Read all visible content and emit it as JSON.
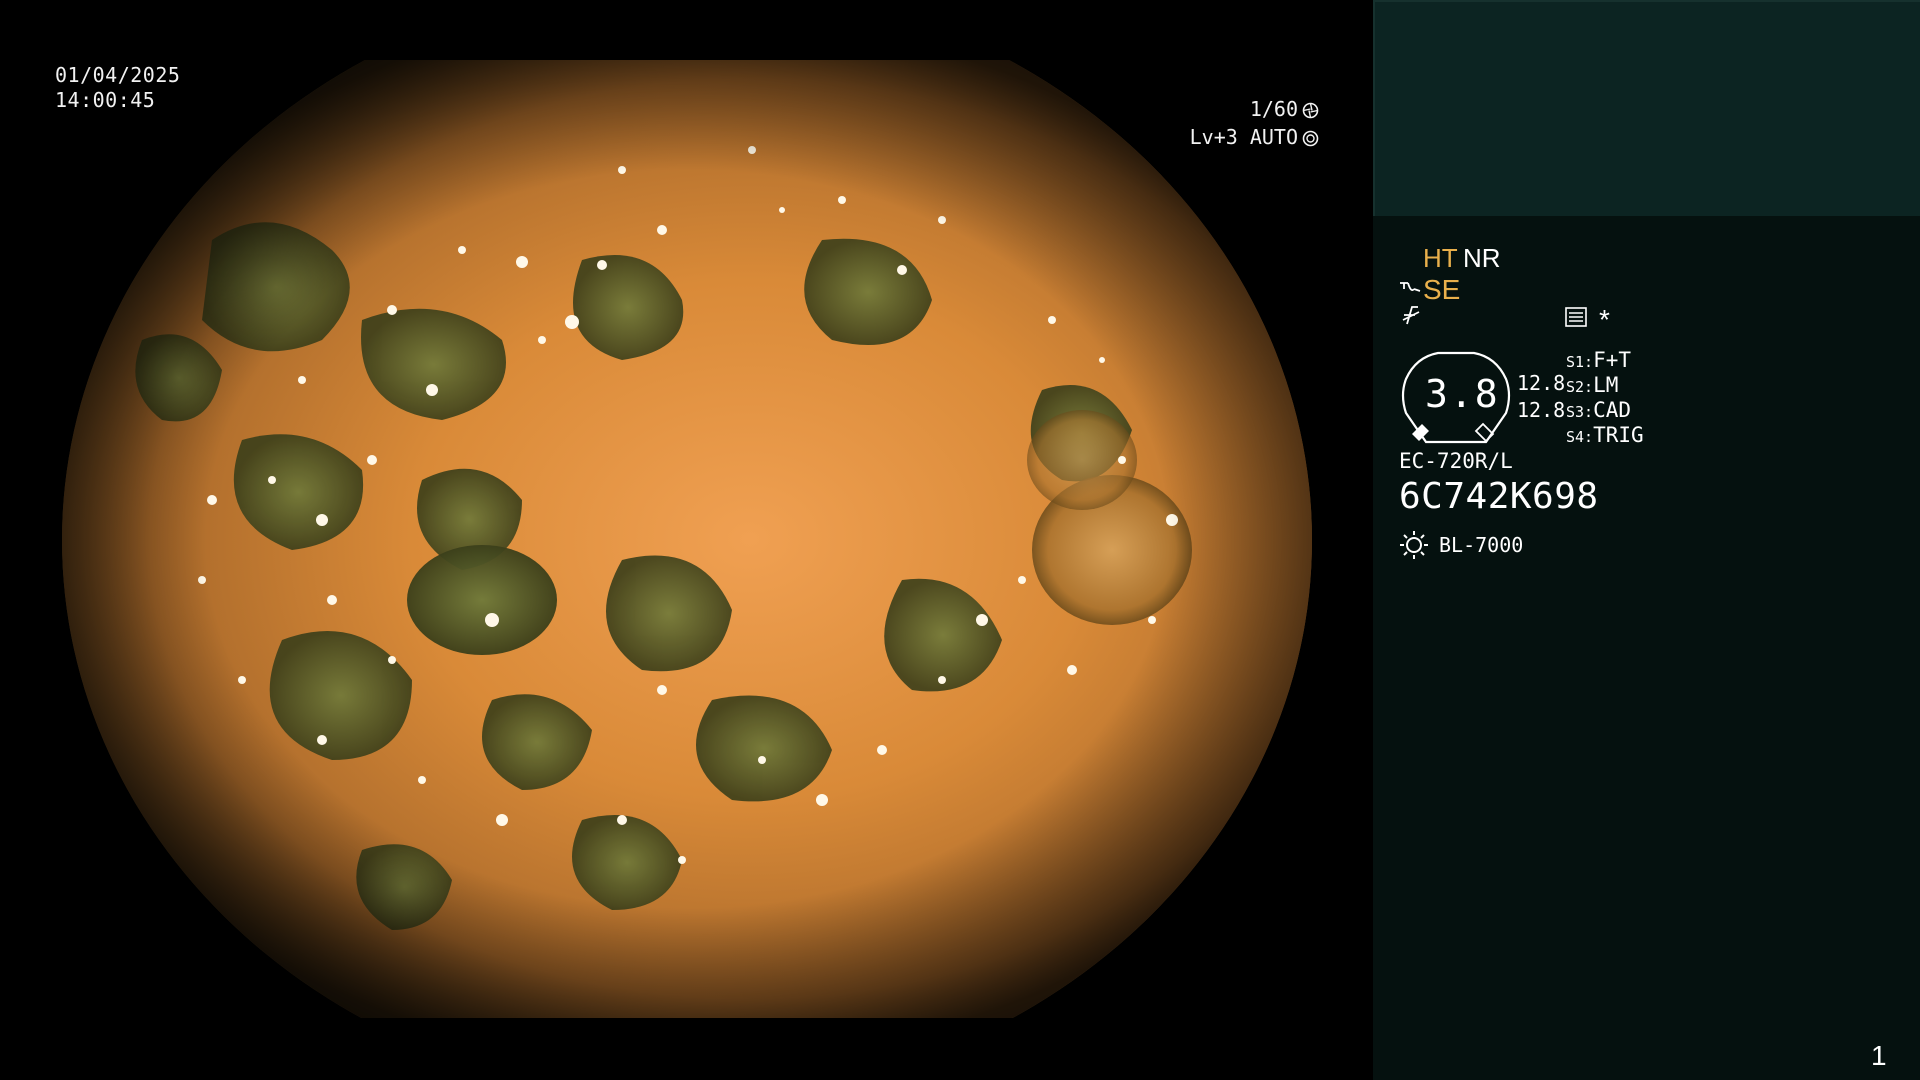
{
  "overlay": {
    "date": "01/04/2025",
    "time": "14:00:45",
    "shutter": "1/60",
    "level": "Lv+3 AUTO"
  },
  "panel": {
    "mode_ht": "HT",
    "mode_nr": "NR",
    "mode_se": "SE",
    "zoom_value": "3.8",
    "gain_1": "12.8",
    "gain_2": "12.8",
    "switches": [
      {
        "key": "S1:",
        "value": "F+T"
      },
      {
        "key": "S2:",
        "value": "LM"
      },
      {
        "key": "S3:",
        "value": "CAD"
      },
      {
        "key": "S4:",
        "value": "TRIG"
      }
    ],
    "asterisk": "*",
    "scope_model": "EC-720R/L",
    "serial": "6C742K698",
    "light_source": "BL-7000",
    "page_number": "1"
  },
  "colors": {
    "panel_bg": "#05110f",
    "panel_header_bg": "#0c2422",
    "accent_amber": "#e9b04c",
    "text": "#ffffff"
  },
  "icons": [
    "shutter-aperture-icon",
    "auto-iris-icon",
    "se-mode-icon",
    "f-mode-icon",
    "menu-icon",
    "zoom-gauge-icon",
    "light-source-icon"
  ]
}
